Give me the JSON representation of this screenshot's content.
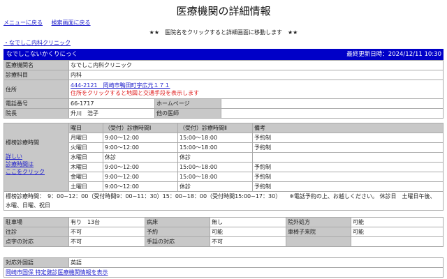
{
  "page_title": "医療機関の詳細情報",
  "nav": {
    "menu": "メニューに戻る",
    "search": "検索画面に戻る"
  },
  "notice": "★★　医院名をクリックすると詳細画面に移動します　★★",
  "clinic_link": "・なでしこ内科クリニック",
  "header": {
    "kana": "なでしこないかくりにっく",
    "updated": "最終更新日時：2024/12/11 10:30",
    "bg_color": "#0000c8"
  },
  "info": {
    "name_label": "医療機関名",
    "name": "なでしこ内科クリニック",
    "dept_label": "診療科目",
    "dept": "内科",
    "addr_label": "住所",
    "addr": "444-2121　岡崎市鴨田町字広元１７１",
    "addr_note": "住所をクリックすると地図と交通手段を表示します",
    "tel_label": "電話番号",
    "tel": "66-1717",
    "hp_label": "ホームページ",
    "hp": "",
    "director_label": "院長",
    "director": "升川　浩子",
    "other_label": "他の医師",
    "other": ""
  },
  "schedule": {
    "label": "標榜診療時間",
    "detail_link": [
      "詳しい",
      "診療時間は",
      "ここをクリック"
    ],
    "headers": [
      "曜日",
      "（受付）診療時間Ⅰ",
      "（受付）診療時間Ⅱ",
      "備考"
    ],
    "rows": [
      [
        "月曜日",
        "9:00～12:00",
        "15:00～18:00",
        "予約制"
      ],
      [
        "火曜日",
        "9:00～12:00",
        "15:00～18:00",
        "予約制"
      ],
      [
        "水曜日",
        "休診",
        "休診",
        ""
      ],
      [
        "木曜日",
        "9:00～12:00",
        "15:00～18:00",
        "予約制"
      ],
      [
        "金曜日",
        "9:00～12:00",
        "15:00～18:00",
        "予約制"
      ],
      [
        "土曜日",
        "9:00～12:00",
        "休診",
        "予約制"
      ]
    ],
    "note": "標榜診療時間：　9：00~12：00（受付時間9：00~11：30）15：00~18：00（受付時間15:00~17：30）　　※電話予約の上、お越しください。 休診日　土曜日午後、 水曜、日曜、祝日"
  },
  "facilities": [
    [
      "駐車場",
      "有り　13台",
      "病床",
      "無し",
      "院外処方",
      "可能"
    ],
    [
      "往診",
      "不可",
      "予約",
      "可能",
      "車椅子来院",
      "可能"
    ],
    [
      "点字の対応",
      "不可",
      "手話の対応",
      "不可",
      "",
      ""
    ]
  ],
  "lang": {
    "label": "対応外国語",
    "value": "英語",
    "link": "岡崎市国保 特定健診医療機関情報を表示"
  }
}
